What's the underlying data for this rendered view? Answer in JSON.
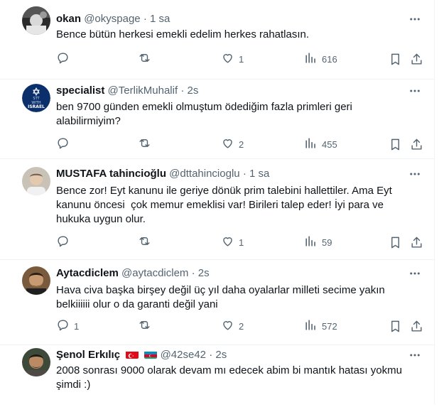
{
  "tweets": [
    {
      "name": "okan",
      "handle": "@okyspage",
      "time": "1 sa",
      "text": [
        "Bence bütün herkesi emekli edelim herkes rahatlasın."
      ],
      "replies": "",
      "retweets": "",
      "likes": "1",
      "views": "616"
    },
    {
      "name": "specialist",
      "handle": "@TerlikMuhalif",
      "time": "2s",
      "avatar_text": [
        "STT",
        "WITH",
        "ISRAEL"
      ],
      "text": [
        "ben 9700 günden emekli olmuştum ödediğim fazla primleri geri",
        "alabilirmiyim?"
      ],
      "replies": "",
      "retweets": "",
      "likes": "2",
      "views": "455"
    },
    {
      "name": "MUSTAFA tahincioğlu",
      "handle": "@dttahincioglu",
      "time": "1 sa",
      "text": [
        "Bence zor! Eyt kanunu ile geriye dönük prim talebini hallettiler. Ama Eyt",
        "kanunu öncesi  çok memur emeklisi var! Birileri talep eder! İyi para ve",
        "hukuka uygun olur."
      ],
      "replies": "",
      "retweets": "",
      "likes": "1",
      "views": "59"
    },
    {
      "name": "Aytacdiclem",
      "handle": "@aytacdiclem",
      "time": "2s",
      "text": [
        "Hava civa başka birşey değil üç yıl daha oyalarlar milleti secime yakın",
        "belkiiiiii olur o da garanti değil yani"
      ],
      "replies": "1",
      "retweets": "",
      "likes": "2",
      "views": "572"
    },
    {
      "name": "Şenol Erkılıç",
      "flags": [
        "turkey-flag",
        "azerbaijan-flag"
      ],
      "handle": "@42se42",
      "time": "2s",
      "text": [
        "2008 sonrası 9000 olarak devam mı edecek abim bi mantık hatası yokmu",
        "şimdi :)"
      ]
    }
  ],
  "separator": "·",
  "icons": [
    "more-icon",
    "reply-icon",
    "retweet-icon",
    "like-icon",
    "views-icon",
    "bookmark-icon",
    "share-icon"
  ],
  "colors": {
    "text": "#0f1419",
    "secondary": "#536471",
    "border": "#eff3f4"
  }
}
